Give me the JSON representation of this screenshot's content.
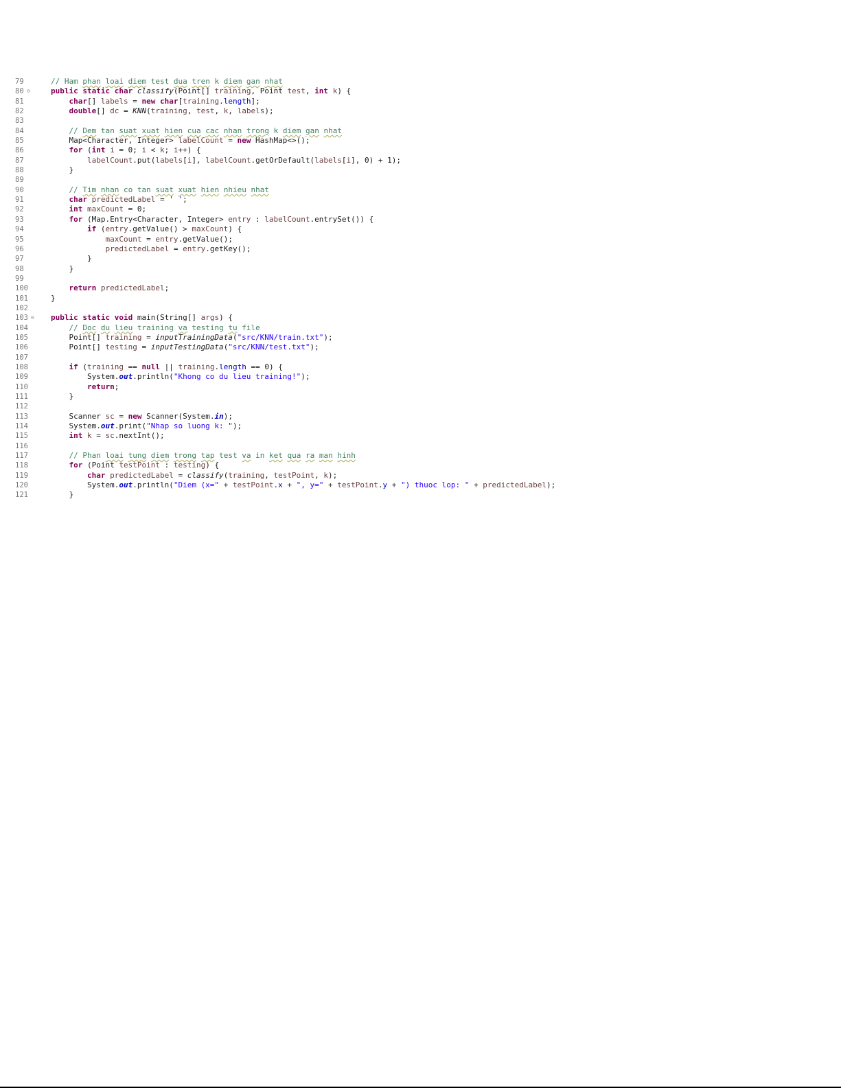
{
  "editor": {
    "lines": [
      {
        "n": "79",
        "code": "// Ham phan loai diem test dua tren k diem gan nhat"
      },
      {
        "n": "80",
        "code": "public static char classify(Point[] training, Point test, int k) {"
      },
      {
        "n": "81",
        "code": "    char[] labels = new char[training.length];"
      },
      {
        "n": "82",
        "code": "    double[] dc = KNN(training, test, k, labels);"
      },
      {
        "n": "83",
        "code": ""
      },
      {
        "n": "84",
        "code": "    // Dem tan suat xuat hien cua cac nhan trong k diem gan nhat"
      },
      {
        "n": "85",
        "code": "    Map<Character, Integer> labelCount = new HashMap<>();"
      },
      {
        "n": "86",
        "code": "    for (int i = 0; i < k; i++) {"
      },
      {
        "n": "87",
        "code": "        labelCount.put(labels[i], labelCount.getOrDefault(labels[i], 0) + 1);"
      },
      {
        "n": "88",
        "code": "    }"
      },
      {
        "n": "89",
        "code": ""
      },
      {
        "n": "90",
        "code": "    // Tim nhan co tan suat xuat hien nhieu nhat"
      },
      {
        "n": "91",
        "code": "    char predictedLabel = ' ';"
      },
      {
        "n": "92",
        "code": "    int maxCount = 0;"
      },
      {
        "n": "93",
        "code": "    for (Map.Entry<Character, Integer> entry : labelCount.entrySet()) {"
      },
      {
        "n": "94",
        "code": "        if (entry.getValue() > maxCount) {"
      },
      {
        "n": "95",
        "code": "            maxCount = entry.getValue();"
      },
      {
        "n": "96",
        "code": "            predictedLabel = entry.getKey();"
      },
      {
        "n": "97",
        "code": "        }"
      },
      {
        "n": "98",
        "code": "    }"
      },
      {
        "n": "99",
        "code": ""
      },
      {
        "n": "100",
        "code": "    return predictedLabel;"
      },
      {
        "n": "101",
        "code": "}"
      },
      {
        "n": "102",
        "code": ""
      },
      {
        "n": "103",
        "code": "public static void main(String[] args) {"
      },
      {
        "n": "104",
        "code": "    // Doc du lieu training va testing tu file"
      },
      {
        "n": "105",
        "code": "    Point[] training = inputTrainingData(\"src/KNN/train.txt\");"
      },
      {
        "n": "106",
        "code": "    Point[] testing = inputTestingData(\"src/KNN/test.txt\");"
      },
      {
        "n": "107",
        "code": ""
      },
      {
        "n": "108",
        "code": "    if (training == null || training.length == 0) {"
      },
      {
        "n": "109",
        "code": "        System.out.println(\"Khong co du lieu training!\");"
      },
      {
        "n": "110",
        "code": "        return;"
      },
      {
        "n": "111",
        "code": "    }"
      },
      {
        "n": "112",
        "code": ""
      },
      {
        "n": "113",
        "code": "    Scanner sc = new Scanner(System.in);"
      },
      {
        "n": "114",
        "code": "    System.out.print(\"Nhap so luong k: \");"
      },
      {
        "n": "115",
        "code": "    int k = sc.nextInt();"
      },
      {
        "n": "116",
        "code": ""
      },
      {
        "n": "117",
        "code": "    // Phan loai tung diem trong tap test va in ket qua ra man hinh"
      },
      {
        "n": "118",
        "code": "    for (Point testPoint : testing) {"
      },
      {
        "n": "119",
        "code": "        char predictedLabel = classify(training, testPoint, k);"
      },
      {
        "n": "120",
        "code": "        System.out.println(\"Diem (x=\" + testPoint.x + \", y=\" + testPoint.y + \") thuoc lop: \" + predictedLabel);"
      },
      {
        "n": "121",
        "code": "    }"
      }
    ],
    "fold_markers": [
      "80",
      "103"
    ],
    "colors": {
      "keyword": "#7f0055",
      "comment": "#3f7f5f",
      "string": "#2a00ff",
      "field": "#0000c0",
      "local_variable": "#6a3e3e",
      "line_number": "#787878"
    }
  }
}
